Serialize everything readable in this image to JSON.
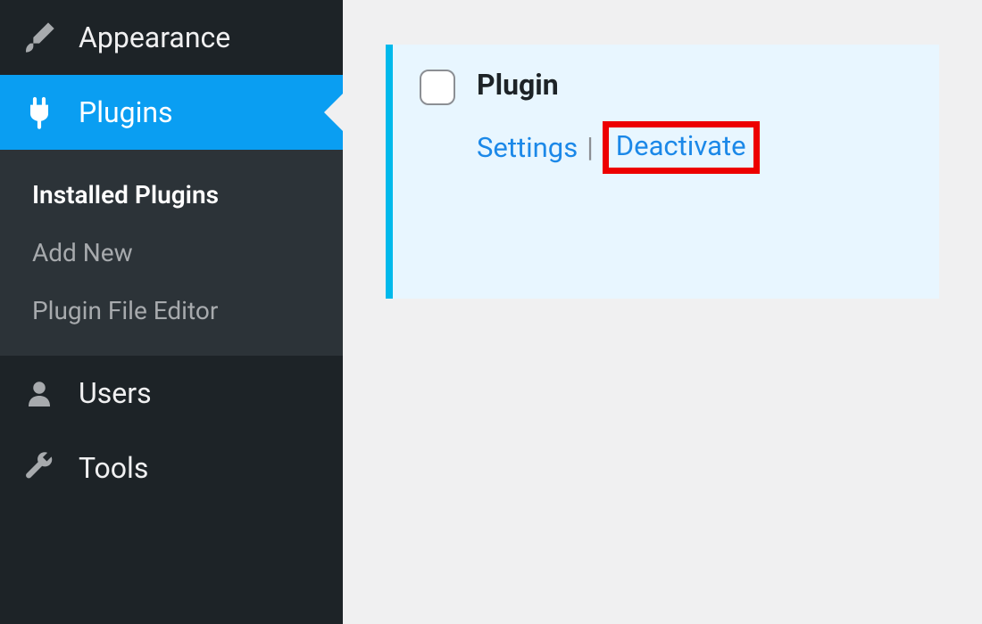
{
  "sidebar": {
    "items": [
      {
        "label": "Appearance"
      },
      {
        "label": "Plugins"
      },
      {
        "label": "Users"
      },
      {
        "label": "Tools"
      }
    ],
    "submenu": [
      {
        "label": "Installed Plugins"
      },
      {
        "label": "Add New"
      },
      {
        "label": "Plugin File Editor"
      }
    ]
  },
  "main": {
    "plugin_title": "Plugin",
    "settings_link": "Settings",
    "separator": "|",
    "deactivate_link": "Deactivate"
  }
}
